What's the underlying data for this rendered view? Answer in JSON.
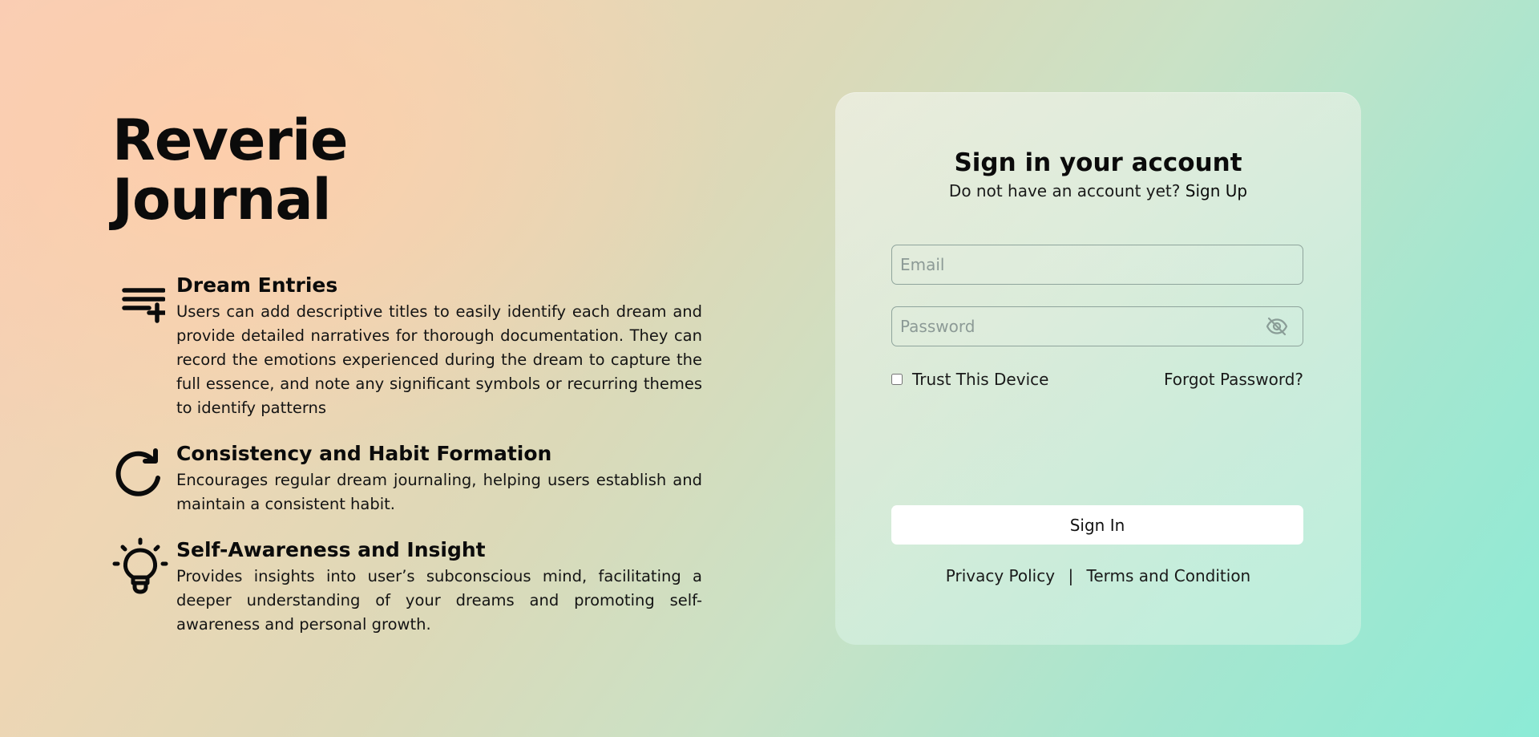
{
  "brand": {
    "line1": "Reverie",
    "line2": "Journal"
  },
  "features": [
    {
      "icon": "playlist-add-icon",
      "title": "Dream Entries",
      "description": "Users can add descriptive titles to easily identify each dream and provide detailed narratives for thorough documentation. They can record the emotions experienced during the dream to capture the full essence, and note any significant symbols or recurring themes to identify patterns"
    },
    {
      "icon": "refresh-icon",
      "title": "Consistency and Habit Formation",
      "description": "Encourages regular dream journaling, helping users establish and maintain a consistent habit."
    },
    {
      "icon": "lightbulb-icon",
      "title": "Self-Awareness and Insight",
      "description": "Provides insights into user’s subconscious mind, facilitating a deeper understanding of your dreams and promoting self-awareness and personal growth."
    }
  ],
  "signin": {
    "title": "Sign in your account",
    "subtitle": "Do not have an account yet?",
    "signup_link": "Sign Up",
    "email": {
      "value": "",
      "placeholder": "Email"
    },
    "password": {
      "value": "",
      "placeholder": "Password",
      "toggle_icon": "eye-off-icon"
    },
    "trust_label": "Trust This Device",
    "trust_checked": false,
    "forgot_link": "Forgot Password?",
    "submit_label": "Sign In",
    "privacy_link": "Privacy Policy",
    "separator": "|",
    "terms_link": "Terms and Condition"
  },
  "colors": {
    "text": "#0b0b0b",
    "button_bg": "#ffffff",
    "input_border": "#8fa49c",
    "placeholder": "#8c9a96",
    "gradient_start": "#f7cdb8",
    "gradient_end": "#8cebd6"
  }
}
